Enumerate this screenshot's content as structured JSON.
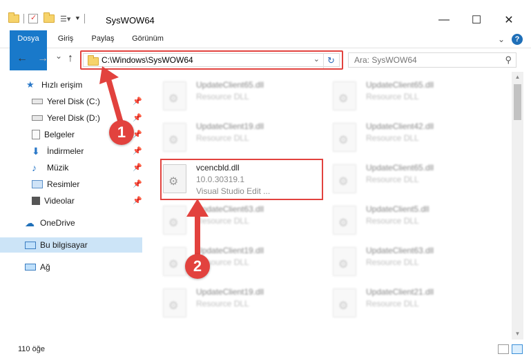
{
  "window": {
    "title": "SysWOW64",
    "minimize": "—",
    "maximize": "☐",
    "close": "✕"
  },
  "ribbon": {
    "tabs": [
      "Dosya",
      "Giriş",
      "Paylaş",
      "Görünüm"
    ],
    "help": "?"
  },
  "nav": {
    "back": "←",
    "forward": "→",
    "recent": "⌄",
    "up": "↑"
  },
  "address": {
    "path": "C:\\Windows\\SysWOW64",
    "dropdown": "⌄",
    "refresh": "↻"
  },
  "search": {
    "placeholder": "Ara: SysWOW64",
    "icon": "search-icon"
  },
  "sidebar": {
    "items": [
      {
        "label": "Hızlı erişim",
        "icon": "star-icon",
        "pinned": false
      },
      {
        "label": "Yerel Disk (C:)",
        "icon": "drive-icon",
        "pinned": true
      },
      {
        "label": "Yerel Disk (D:)",
        "icon": "drive-icon",
        "pinned": true
      },
      {
        "label": "Belgeler",
        "icon": "documents-icon",
        "pinned": true
      },
      {
        "label": "İndirmeler",
        "icon": "download-icon",
        "pinned": true
      },
      {
        "label": "Müzik",
        "icon": "music-icon",
        "pinned": true
      },
      {
        "label": "Resimler",
        "icon": "pictures-icon",
        "pinned": true
      },
      {
        "label": "Videolar",
        "icon": "videos-icon",
        "pinned": true
      },
      {
        "label": "OneDrive",
        "icon": "cloud-icon",
        "pinned": false
      },
      {
        "label": "Bu bilgisayar",
        "icon": "computer-icon",
        "pinned": false
      },
      {
        "label": "Ağ",
        "icon": "network-icon",
        "pinned": false
      }
    ]
  },
  "files": [
    {
      "name": "UpdateClient65.dll",
      "desc": "Resource DLL",
      "blurred": true
    },
    {
      "name": "UpdateClient65.dll",
      "desc": "Resource DLL",
      "blurred": true
    },
    {
      "name": "UpdateClient19.dll",
      "desc": "Resource DLL",
      "blurred": true
    },
    {
      "name": "UpdateClient42.dll",
      "desc": "Resource DLL",
      "blurred": true
    },
    {
      "name": "vcencbld.dll",
      "desc": "10.0.30319.1",
      "extra": "Visual Studio Edit ...",
      "blurred": false
    },
    {
      "name": "UpdateClient65.dll",
      "desc": "Resource DLL",
      "blurred": true
    },
    {
      "name": "UpdateClient63.dll",
      "desc": "Resource DLL",
      "blurred": true
    },
    {
      "name": "UpdateClient5.dll",
      "desc": "Resource DLL",
      "blurred": true
    },
    {
      "name": "UpdateClient19.dll",
      "desc": "Resource DLL",
      "blurred": true
    },
    {
      "name": "UpdateClient63.dll",
      "desc": "Resource DLL",
      "blurred": true
    },
    {
      "name": "UpdateClient19.dll",
      "desc": "Resource DLL",
      "blurred": true
    },
    {
      "name": "UpdateClient21.dll",
      "desc": "Resource DLL",
      "blurred": true
    }
  ],
  "status": {
    "count": "110 öğe"
  },
  "annotations": {
    "badge1": "1",
    "badge2": "2",
    "color": "#e2423e"
  }
}
